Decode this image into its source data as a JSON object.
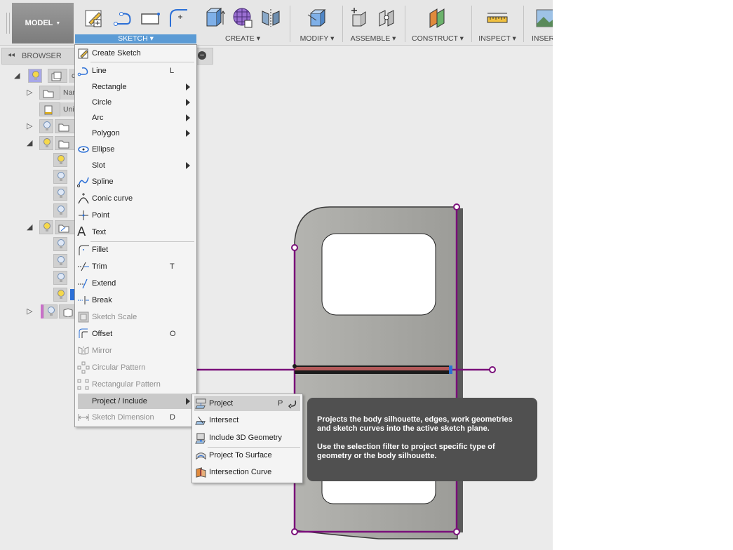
{
  "toolbar": {
    "model_label": "MODEL",
    "groups": [
      {
        "label": "SKETCH",
        "active": true
      },
      {
        "label": "CREATE"
      },
      {
        "label": "MODIFY"
      },
      {
        "label": "ASSEMBLE"
      },
      {
        "label": "CONSTRUCT"
      },
      {
        "label": "INSPECT"
      },
      {
        "label": "INSERT"
      }
    ]
  },
  "browser": {
    "title": "BROWSER",
    "rows": [
      {
        "text": "c"
      },
      {
        "text": "Nar"
      },
      {
        "text": "Unit"
      }
    ]
  },
  "sketch_menu": {
    "items": [
      {
        "label": "Create Sketch",
        "icon": "create-sketch-icon"
      },
      {
        "label": "Line",
        "shortcut": "L",
        "icon": "line-icon"
      },
      {
        "label": "Rectangle",
        "submenu": true
      },
      {
        "label": "Circle",
        "submenu": true
      },
      {
        "label": "Arc",
        "submenu": true
      },
      {
        "label": "Polygon",
        "submenu": true
      },
      {
        "label": "Ellipse",
        "icon": "ellipse-icon"
      },
      {
        "label": "Slot",
        "submenu": true
      },
      {
        "label": "Spline",
        "icon": "spline-icon"
      },
      {
        "label": "Conic curve",
        "icon": "conic-curve-icon"
      },
      {
        "label": "Point",
        "icon": "point-icon"
      },
      {
        "label": "Text",
        "icon": "text-icon"
      },
      {
        "label": "Fillet",
        "icon": "fillet-icon"
      },
      {
        "label": "Trim",
        "shortcut": "T",
        "icon": "trim-icon"
      },
      {
        "label": "Extend",
        "icon": "extend-icon"
      },
      {
        "label": "Break",
        "icon": "break-icon"
      },
      {
        "label": "Sketch Scale",
        "disabled": true,
        "icon": "sketch-scale-icon"
      },
      {
        "label": "Offset",
        "shortcut": "O",
        "icon": "offset-icon"
      },
      {
        "label": "Mirror",
        "disabled": true,
        "icon": "mirror-icon"
      },
      {
        "label": "Circular Pattern",
        "disabled": true,
        "icon": "circular-pattern-icon"
      },
      {
        "label": "Rectangular Pattern",
        "disabled": true,
        "icon": "rectangular-pattern-icon"
      },
      {
        "label": "Project / Include",
        "submenu": true,
        "highlighted": true
      },
      {
        "label": "Sketch Dimension",
        "shortcut": "D",
        "disabled": true,
        "icon": "sketch-dimension-icon"
      }
    ]
  },
  "project_submenu": {
    "items": [
      {
        "label": "Project",
        "shortcut": "P",
        "icon": "project-icon",
        "highlighted": true
      },
      {
        "label": "Intersect",
        "icon": "intersect-icon"
      },
      {
        "label": "Include 3D Geometry",
        "icon": "include-3d-geometry-icon"
      },
      {
        "label": "Project To Surface",
        "icon": "project-to-surface-icon"
      },
      {
        "label": "Intersection Curve",
        "icon": "intersection-curve-icon"
      }
    ]
  },
  "tooltip": {
    "line1": "Projects the body silhouette, edges, work geometries and sketch curves into the active sketch plane.",
    "line2": "Use the selection filter to project specific type of geometry or the body silhouette."
  },
  "colors": {
    "accent": "#5b9bd5",
    "sketch_line": "#7a0f7a",
    "body_fill": "#a6a6a2",
    "tooltip_bg": "#505050"
  }
}
